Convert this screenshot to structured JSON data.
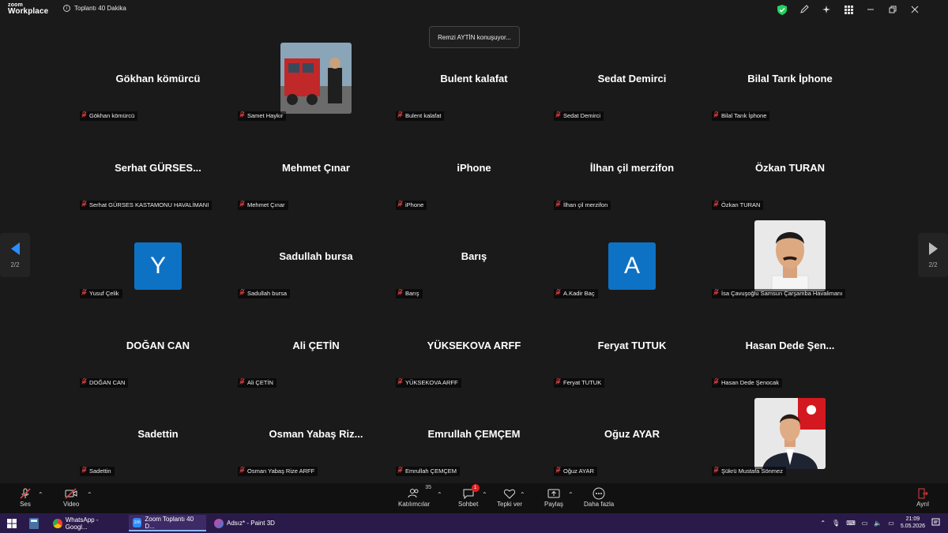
{
  "app": {
    "logo_line1": "zoom",
    "logo_line2": "Workplace",
    "meeting_title": "Toplantı 40 Dakika"
  },
  "speaking_banner": "Remzi AYTİN konuşuyor...",
  "colors": {
    "accent": "#2d8cff",
    "avatar_bg": "#0e72c4",
    "mute_red": "#e04040",
    "shield_green": "#23d160"
  },
  "tiles": [
    {
      "name": "Gökhan  kömürcü",
      "label": "Gökhan  kömürcü"
    },
    {
      "name": "",
      "label": "Samet Haykır",
      "photo": "truck"
    },
    {
      "name": "Bulent kalafat",
      "label": "Bulent kalafat"
    },
    {
      "name": "Sedat Demirci",
      "label": "Sedat Demirci"
    },
    {
      "name": "Bilal Tarık İphone",
      "label": "Bilal Tarık İphone"
    },
    {
      "name": "Serhat  GÜRSES...",
      "label": "Serhat GÜRSES KASTAMONU HAVALİMANI"
    },
    {
      "name": "Mehmet Çınar",
      "label": "Mehmet Çınar"
    },
    {
      "name": "iPhone",
      "label": "iPhone"
    },
    {
      "name": "İlhan çil merzifon",
      "label": "İlhan çil merzifon"
    },
    {
      "name": "Özkan TURAN",
      "label": "Özkan TURAN"
    },
    {
      "name": "",
      "label": "Yusuf Çelik",
      "avatar": "Y"
    },
    {
      "name": "Sadullah bursa",
      "label": "Sadullah bursa"
    },
    {
      "name": "Barış",
      "label": "Barış"
    },
    {
      "name": "",
      "label": "A.Kadir Baç",
      "avatar": "A"
    },
    {
      "name": "",
      "label": "İsa Çavuşoğlu Samsun Çarşamba Havalimanı",
      "photo": "face1"
    },
    {
      "name": "DOĞAN CAN",
      "label": "DOĞAN CAN"
    },
    {
      "name": "Ali ÇETİN",
      "label": "Ali ÇETİN"
    },
    {
      "name": "YÜKSEKOVA ARFF",
      "label": "YÜKSEKOVA ARFF"
    },
    {
      "name": "Feryat TUTUK",
      "label": "Feryat TUTUK"
    },
    {
      "name": "Hasan Dede Şen...",
      "label": "Hasan Dede Şenocak"
    },
    {
      "name": "Sadettin",
      "label": "Sadettin"
    },
    {
      "name": "Osman Yabaş Riz...",
      "label": "Osman Yabaş Rize ARFF"
    },
    {
      "name": "Emrullah ÇEMÇEM",
      "label": "Emrullah ÇEMÇEM"
    },
    {
      "name": "Oğuz AYAR",
      "label": "Oğuz AYAR"
    },
    {
      "name": "",
      "label": "Şükrü Mustafa Sönmez",
      "photo": "face2"
    }
  ],
  "pager": {
    "left_page": "2/2",
    "right_page": "2/2"
  },
  "toolbar": {
    "audio_label": "Ses",
    "video_label": "Video",
    "participants_label": "Katılımcılar",
    "participants_count": "35",
    "chat_label": "Sohbet",
    "chat_badge": "1",
    "react_label": "Tepki ver",
    "share_label": "Paylaş",
    "more_label": "Daha fazla",
    "leave_label": "Ayrıl"
  },
  "taskbar": {
    "items": [
      "WhatsApp - Googl...",
      "Zoom Toplantı 40 D...",
      "Adsız* - Paint 3D"
    ],
    "time": "21:09",
    "date": "5.05.2026"
  }
}
